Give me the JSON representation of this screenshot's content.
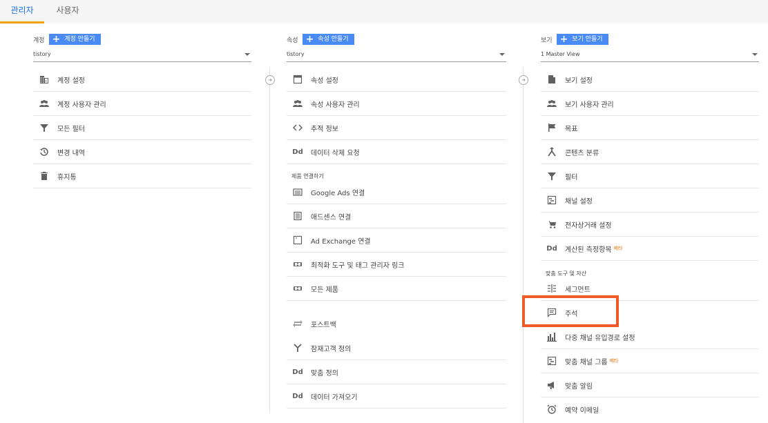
{
  "tabs": [
    {
      "label": "관리자",
      "active": true
    },
    {
      "label": "사용자",
      "active": false
    }
  ],
  "account": {
    "label": "계정",
    "create_label": "계정 만들기",
    "selected": "tistory",
    "items": [
      "계정 설정",
      "계정 사용자 관리",
      "모든 필터",
      "변경 내역",
      "휴지통"
    ]
  },
  "property": {
    "label": "속성",
    "create_label": "속성 만들기",
    "selected": "tistory",
    "items": [
      "속성 설정",
      "속성 사용자 관리",
      "추적 정보",
      "데이터 삭제 요청"
    ],
    "product_section": "제품 연결하기",
    "product_items": [
      "Google Ads 연결",
      "애드센스 연결",
      "Ad Exchange 연결",
      "최적화 도구 및 태그 관리자 링크",
      "모든 제품"
    ],
    "other_items": [
      "포스트백",
      "잠재고객 정의",
      "맞춤 정의",
      "데이터 가져오기"
    ]
  },
  "view": {
    "label": "보기",
    "create_label": "보기 만들기",
    "selected": "1 Master View",
    "items": [
      "보기 설정",
      "보기 사용자 관리",
      "목표",
      "콘텐츠 분류",
      "필터",
      "채널 설정",
      "전자상거래 설정",
      "계산된 측정항목"
    ],
    "beta_label": "베타",
    "tools_section": "맞춤 도구 및 자산",
    "tools_items": [
      "세그먼트",
      "주석",
      "다중 채널 유입경로 설정",
      "맞춤 채널 그룹",
      "맞춤 알림",
      "예약 이메일"
    ]
  },
  "colors": {
    "accent": "#1a73e8",
    "tab_underline": "#f4a300",
    "button": "#4a8af4",
    "highlight": "#f05a28",
    "beta": "#e37400"
  }
}
